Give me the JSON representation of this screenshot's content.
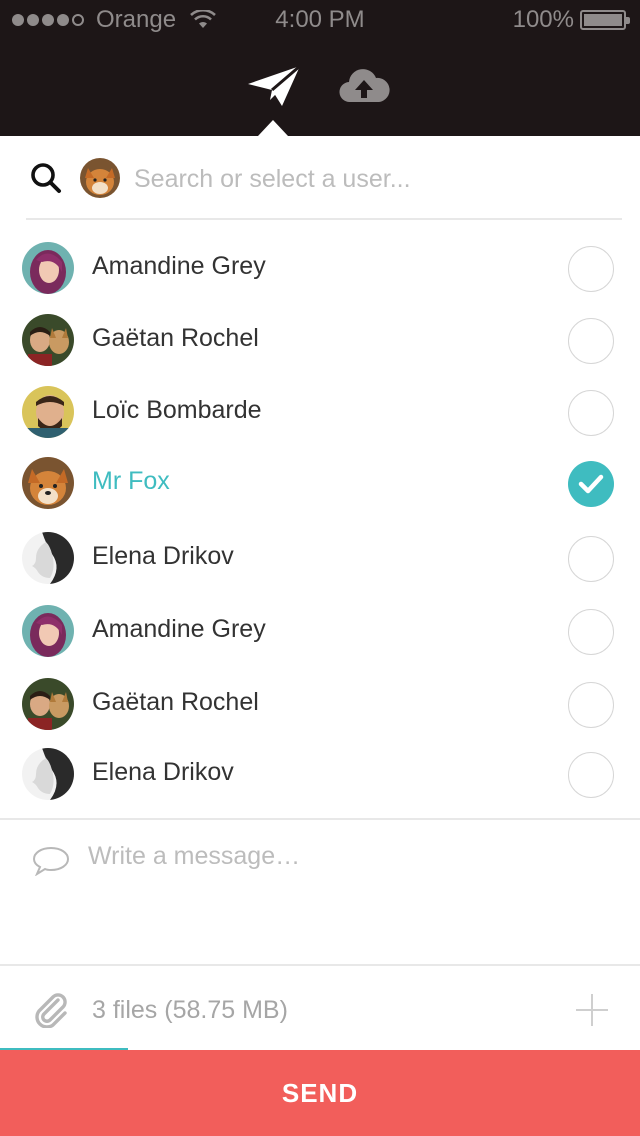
{
  "status_bar": {
    "carrier": "Orange",
    "time": "4:00 PM",
    "battery": "100%"
  },
  "nav": {
    "active_tab": "send",
    "icons": [
      "paper-plane-icon",
      "cloud-upload-icon"
    ]
  },
  "search": {
    "placeholder": "Search or select a user..."
  },
  "users": [
    {
      "name": "Amandine Grey",
      "selected": false,
      "avatar": "avatar-purple"
    },
    {
      "name": "Gaëtan Rochel",
      "selected": false,
      "avatar": "avatar-green"
    },
    {
      "name": "Loïc Bombarde",
      "selected": false,
      "avatar": "avatar-yellow"
    },
    {
      "name": "Mr Fox",
      "selected": true,
      "avatar": "avatar-fox"
    },
    {
      "name": "Elena Drikov",
      "selected": false,
      "avatar": "avatar-grey"
    },
    {
      "name": "Amandine Grey",
      "selected": false,
      "avatar": "avatar-purple"
    },
    {
      "name": "Gaëtan Rochel",
      "selected": false,
      "avatar": "avatar-green"
    },
    {
      "name": "Elena Drikov",
      "selected": false,
      "avatar": "avatar-grey"
    }
  ],
  "message": {
    "placeholder": "Write a message…"
  },
  "files": {
    "label": "3 files (58.75 MB)",
    "upload_progress": 0.2
  },
  "send_button": {
    "label": "SEND"
  },
  "colors": {
    "header_bg": "#1d1617",
    "accent": "#3fbcc0",
    "send_bg": "#f25e5b"
  }
}
